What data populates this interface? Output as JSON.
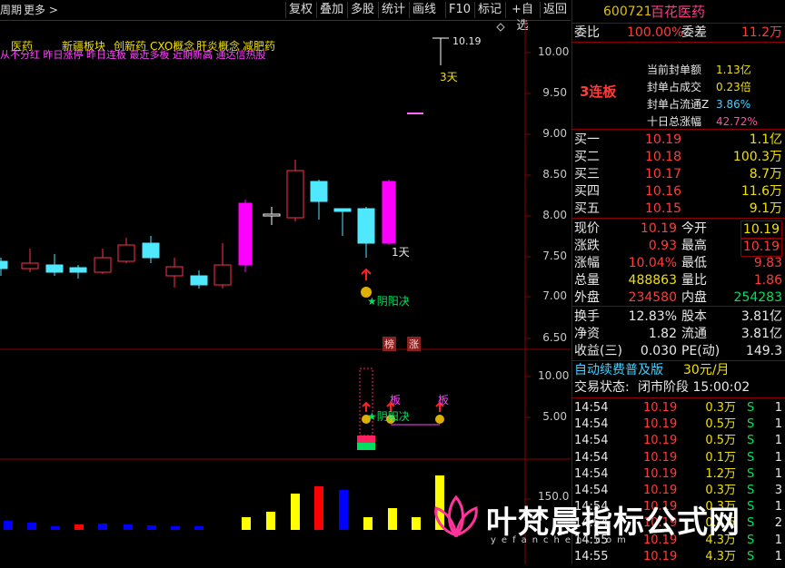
{
  "toolbar": {
    "left_label": "周期",
    "more_label": "更多 >",
    "buttons": [
      "复权",
      "叠加",
      "多股",
      "统计",
      "画线",
      "F10",
      "标记",
      "+自选",
      "返回"
    ]
  },
  "chart": {
    "concepts": [
      "医药",
      "新疆板块",
      "创新药",
      "CXO概念",
      "肝炎概念",
      "减肥药"
    ],
    "tags_line": "从不分红 昨日涨停 昨日连板 最近多板 近期新高 通达信热股",
    "price_axis": [
      "10.00",
      "9.50",
      "9.00",
      "8.50",
      "8.00",
      "7.50",
      "7.00",
      "6.50"
    ],
    "high_price_label": "10.19",
    "days_label_top": "3天",
    "days_label_bottom": "1天",
    "yinyang_label": "阴阳决",
    "badges": [
      "榜",
      "涨"
    ],
    "sub_axis": [
      "10.00",
      "5.00"
    ],
    "ban_labels": [
      "板",
      "板"
    ],
    "sub_yinyang": "阴阳决",
    "vol_axis_label": "150.0",
    "colors": {
      "up": "#ff3050",
      "down": "#50e8ff",
      "magenta": "#ff00ff",
      "yellow": "#ffff00",
      "blue": "#0000ff",
      "red": "#ff0000"
    }
  },
  "panel": {
    "code": "600721",
    "name": "百花医药",
    "weibi_label": "委比",
    "weibi": "100.00%",
    "weicha_label": "委差",
    "weicha": "11.2万",
    "board": "3连板",
    "seal_items": [
      {
        "label": "当前封单额",
        "value": "1.13亿"
      },
      {
        "label": "封单占成交",
        "value": "0.23倍"
      },
      {
        "label": "封单占流通Z",
        "value": "3.86%"
      },
      {
        "label": "十日总涨幅",
        "value": "42.72%"
      }
    ],
    "bids": [
      {
        "label": "买一",
        "price": "10.19",
        "vol": "1.1亿"
      },
      {
        "label": "买二",
        "price": "10.18",
        "vol": "100.3万"
      },
      {
        "label": "买三",
        "price": "10.17",
        "vol": "8.7万"
      },
      {
        "label": "买四",
        "price": "10.16",
        "vol": "11.6万"
      },
      {
        "label": "买五",
        "price": "10.15",
        "vol": "9.1万"
      }
    ],
    "quote": [
      {
        "l1": "现价",
        "v1": "10.19",
        "l2": "今开",
        "v2": "10.19"
      },
      {
        "l1": "涨跌",
        "v1": "0.93",
        "l2": "最高",
        "v2": "10.19"
      },
      {
        "l1": "涨幅",
        "v1": "10.04%",
        "l2": "最低",
        "v2": "9.83"
      },
      {
        "l1": "总量",
        "v1": "488863",
        "l2": "量比",
        "v2": "1.86"
      },
      {
        "l1": "外盘",
        "v1": "234580",
        "l2": "内盘",
        "v2": "254283"
      }
    ],
    "fin": [
      {
        "l1": "换手",
        "v1": "12.83%",
        "l2": "股本",
        "v2": "3.81亿"
      },
      {
        "l1": "净资",
        "v1": "1.82",
        "l2": "流通",
        "v2": "3.81亿"
      },
      {
        "l1": "收益(三)",
        "v1": "0.030",
        "l2": "PE(动)",
        "v2": "149.3"
      }
    ],
    "promo": "自动续费普及版",
    "promo_price": "30元/月",
    "status_label": "交易状态:",
    "status_value": "闭市阶段 15:00:02",
    "ticks": [
      {
        "t": "14:54",
        "p": "10.19",
        "v": "0.3万",
        "s": "S",
        "n": "1"
      },
      {
        "t": "14:54",
        "p": "10.19",
        "v": "0.5万",
        "s": "S",
        "n": "1"
      },
      {
        "t": "14:54",
        "p": "10.19",
        "v": "0.5万",
        "s": "S",
        "n": "1"
      },
      {
        "t": "14:54",
        "p": "10.19",
        "v": "0.1万",
        "s": "S",
        "n": "1"
      },
      {
        "t": "14:54",
        "p": "10.19",
        "v": "1.2万",
        "s": "S",
        "n": "1"
      },
      {
        "t": "14:54",
        "p": "10.19",
        "v": "0.3万",
        "s": "S",
        "n": "3"
      },
      {
        "t": "14:54",
        "p": "10.19",
        "v": "0.3万",
        "s": "S",
        "n": "1"
      },
      {
        "t": "14:54",
        "p": "10.19",
        "v": "0.4万",
        "s": "S",
        "n": "2"
      },
      {
        "t": "14:55",
        "p": "10.19",
        "v": "4.3万",
        "s": "S",
        "n": "1"
      },
      {
        "t": "14:55",
        "p": "10.19",
        "v": "4.3万",
        "s": "S",
        "n": "1"
      }
    ]
  },
  "watermark": {
    "title": "叶梵晨指标公式网",
    "sub": "yefanchen.com"
  }
}
